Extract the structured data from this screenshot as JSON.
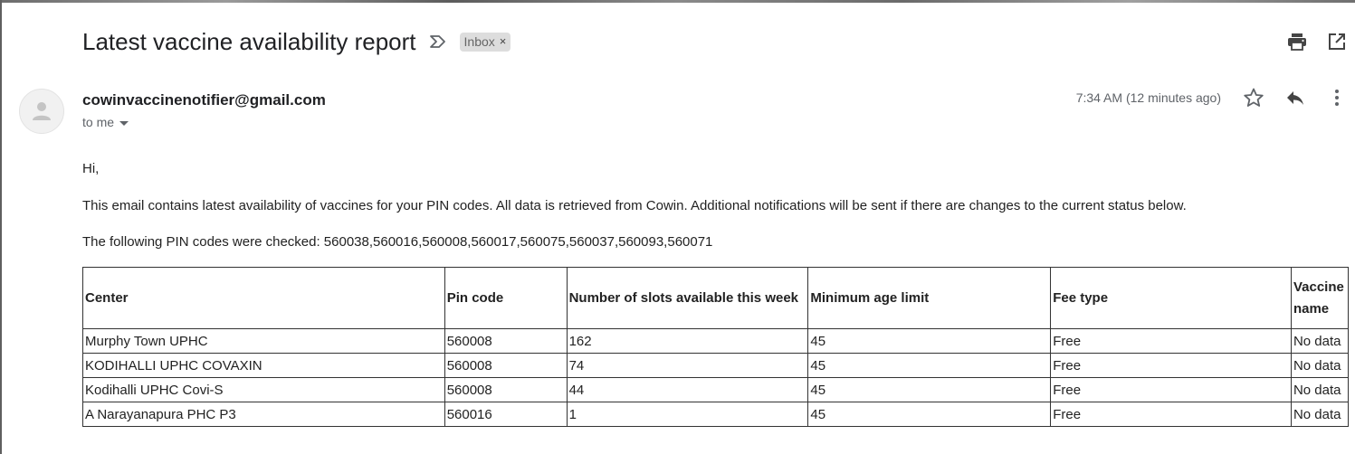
{
  "subject": "Latest vaccine availability report",
  "label": "Inbox",
  "label_close": "×",
  "icons": {
    "importance": "importance-marker-icon",
    "print": "print-icon",
    "new_window": "open-in-new-window-icon",
    "avatar": "default-avatar-icon",
    "star": "star-icon",
    "reply": "reply-icon",
    "more": "more-vert-icon"
  },
  "sender": "cowinvaccinenotifier@gmail.com",
  "recipient": "to me",
  "timestamp": "7:34 AM (12 minutes ago)",
  "body": {
    "greeting": "Hi,",
    "intro": "This email contains latest availability of vaccines for your PIN codes. All data is retrieved from Cowin. Additional notifications will be sent if there are changes to the current status below.",
    "pins_checked": "The following PIN codes were checked: 560038,560016,560008,560017,560075,560037,560093,560071"
  },
  "table": {
    "headers": [
      "Center",
      "Pin code",
      "Number of slots available this week",
      "Minimum age limit",
      "Fee type",
      "Vaccine name"
    ],
    "rows": [
      [
        "Murphy Town UPHC",
        "560008",
        "162",
        "45",
        "Free",
        "No data"
      ],
      [
        "KODIHALLI UPHC COVAXIN",
        "560008",
        "74",
        "45",
        "Free",
        "No data"
      ],
      [
        "Kodihalli UPHC Covi-S",
        "560008",
        "44",
        "45",
        "Free",
        "No data"
      ],
      [
        "A Narayanapura PHC P3",
        "560016",
        "1",
        "45",
        "Free",
        "No data"
      ]
    ]
  },
  "colors": {
    "text": "#222222",
    "secondary_text": "#5f6368",
    "label_chip_bg": "#dddddd",
    "icon": "#5f6368",
    "border": "#333333"
  }
}
